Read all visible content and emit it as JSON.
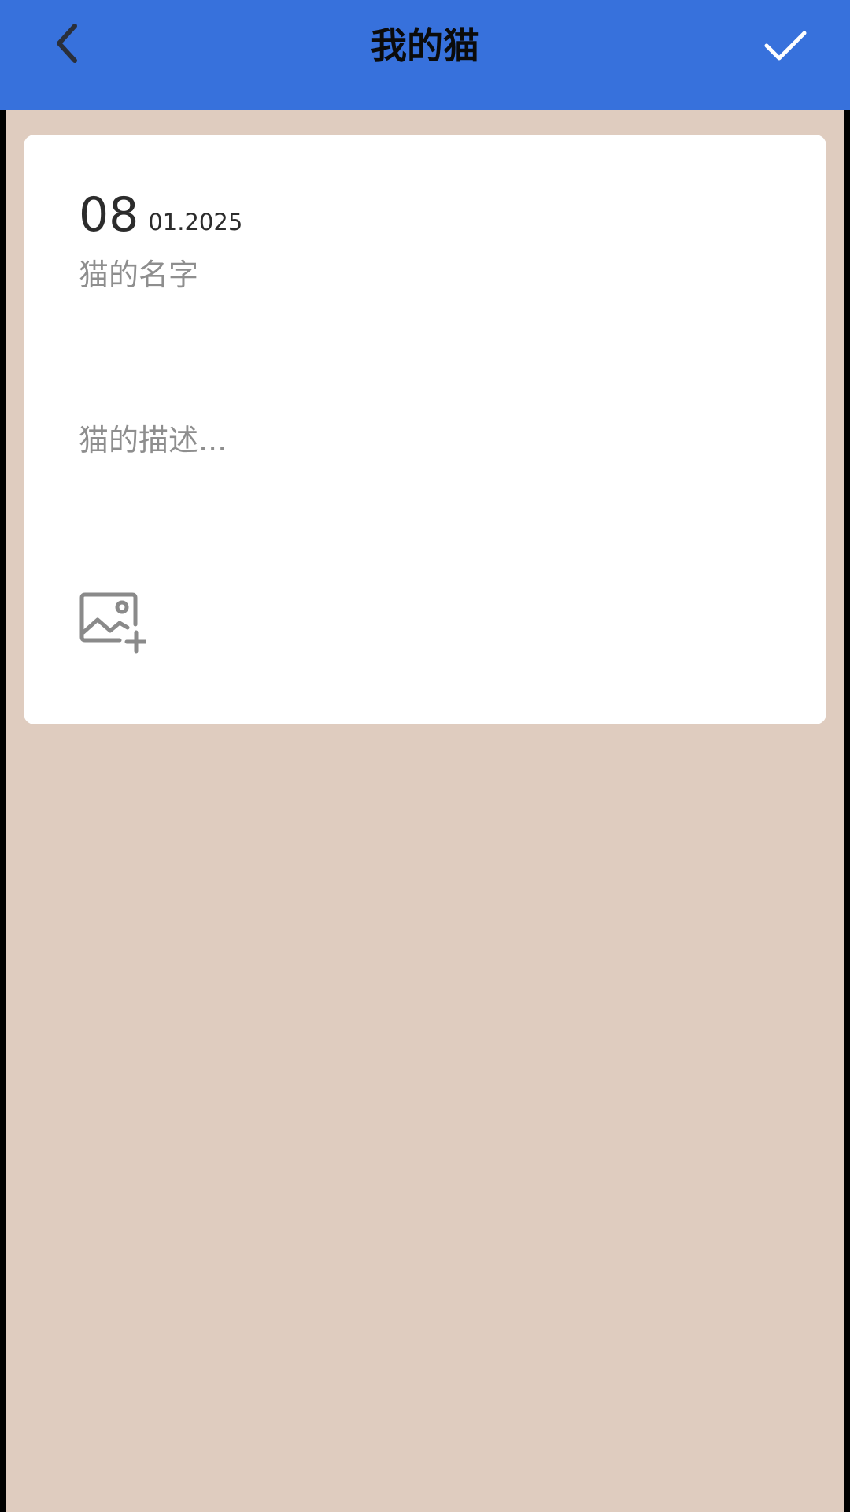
{
  "header": {
    "title": "我的猫",
    "back_icon": "chevron-left-icon",
    "confirm_icon": "checkmark-icon",
    "background_color": "#3771dc"
  },
  "card": {
    "date": {
      "day": "08",
      "month_year": "01.2025"
    },
    "name_placeholder": "猫的名字",
    "description_placeholder": "猫的描述...",
    "add_image_icon": "add-image-icon"
  },
  "colors": {
    "page_background": "#dfccbf",
    "card_background": "#ffffff",
    "placeholder_text": "#8e8e8e"
  }
}
